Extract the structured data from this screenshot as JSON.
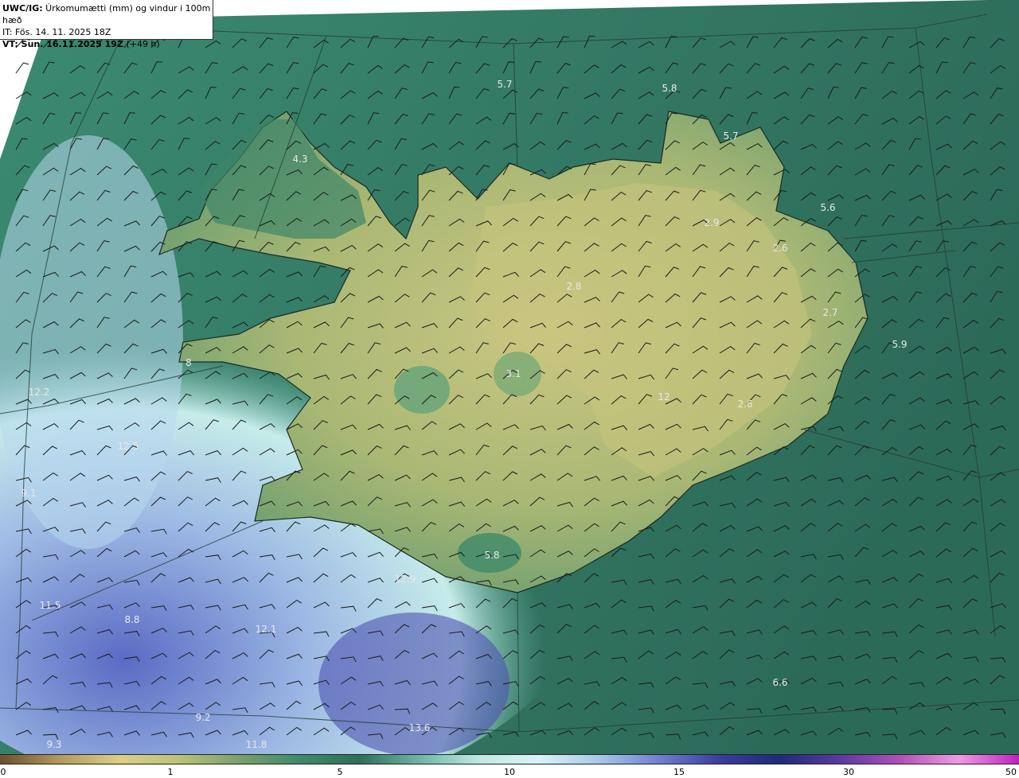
{
  "header": {
    "line1_bold": "UWC/IG:",
    "line1_text": " Úrkomumætti (mm) og vindur i 100m hæð",
    "line2": "IT: Fös. 14. 11. 2025 18Z",
    "line3_bold": "VT: Sun. 16.11.2025 19Z",
    "line3_text": " (+49 h)"
  },
  "map_labels": [
    "5.7",
    "5.8",
    "4.3",
    "5.7",
    "5.6",
    "2.9",
    "2.6",
    "2.8",
    "2.7",
    "5.9",
    "3.1",
    "12.2",
    "12.5",
    "9.1",
    "8",
    "12.9",
    "12.1",
    "6.6",
    "9.2",
    "13.6",
    "9.3",
    "11.8",
    "11.5",
    "2.6",
    "12",
    "5.8",
    "8.8"
  ],
  "colorbar": {
    "ticks": [
      "0",
      "1",
      "5",
      "10",
      "15",
      "30",
      "50"
    ],
    "colors": [
      "#6b4f2f",
      "#b39a5e",
      "#dccf86",
      "#b9c379",
      "#7aa06d",
      "#3f8a6a",
      "#2f6f5a",
      "#6fb6a6",
      "#bfe9e2",
      "#d8f3f6",
      "#a8c8ea",
      "#6f7fd0",
      "#3c3c9c",
      "#1f2a78",
      "#5a3aa0",
      "#b04fb8",
      "#f09be3",
      "#c020c0"
    ],
    "accent_land": "#b9c27a",
    "accent_sea": "#2f7563",
    "accent_wet": "#5b68c0"
  }
}
